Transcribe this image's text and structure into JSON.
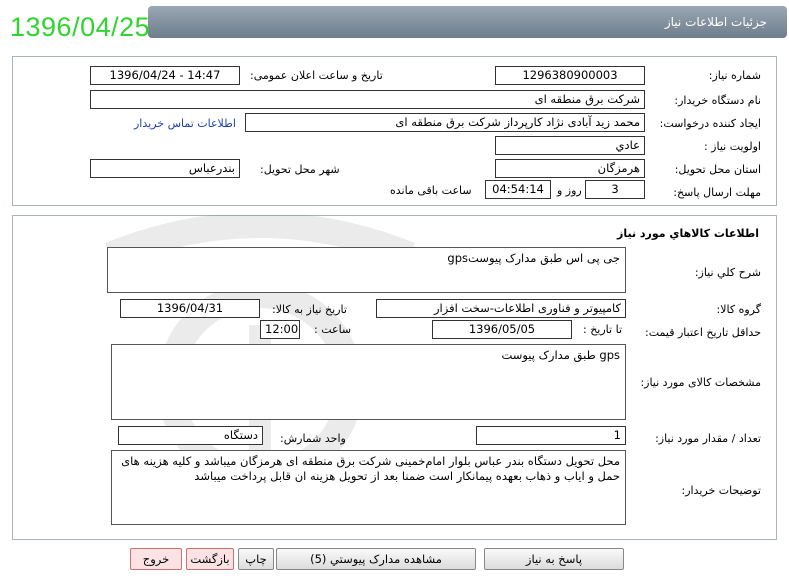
{
  "header": {
    "title": "جزئیات اطلاعات نیاز",
    "date_badge": "1396/04/25"
  },
  "info": {
    "need_number_label": "شماره نیاز:",
    "need_number": "1296380900003",
    "announce_label": "تاریخ و ساعت اعلان عمومی:",
    "announce_value": "1396/04/24 - 14:47",
    "buyer_org_label": "نام دستگاه خریدار:",
    "buyer_org": "شرکت برق منطقه ای",
    "requester_label": "ایجاد کننده درخواست:",
    "requester": "محمد زید آبادی نژاد کارپرداز شرکت برق منطقه ای",
    "contact_link": "اطلاعات تماس خریدار",
    "priority_label": "اولویت نیاز :",
    "priority": "عادي",
    "province_label": "استان محل تحویل:",
    "province": "هرمزگان",
    "city_label": "شهر محل تحویل:",
    "city": "بندرعباس",
    "deadline_label": "مهلت ارسال پاسخ:",
    "deadline_days": "3",
    "days_word": "روز و",
    "deadline_time": "04:54:14",
    "remaining_word": "ساعت باقی مانده"
  },
  "goods": {
    "section_title": "اطلاعات کالاهاي مورد نياز",
    "general_desc_label": "شرح کلي نياز:",
    "general_desc": "جی پی اس  طبق مدارک پیوستgps",
    "group_label": "گروه کالا:",
    "group": "کامپیوتر و فناوری اطلاعات-سخت افزار",
    "need_date_label": "تاریخ نیاز به کالا:",
    "need_date": "1396/04/31",
    "min_validity_label": "حداقل تاریخ اعتبار قیمت:",
    "until_date_label": "تا تاریخ :",
    "until_date": "1396/05/05",
    "time_label": "ساعت :",
    "time": "12:00",
    "specs_label": "مشخصات کالای مورد نیاز:",
    "specs": "gps طبق مدارک پیوست",
    "qty_label": "تعداد / مقدار مورد نیاز:",
    "qty": "1",
    "unit_label": "واحد شمارش:",
    "unit": "دستگاه",
    "buyer_notes_label": "توضیحات خریدار:",
    "buyer_notes": "محل تحویل دستگاه بندر عباس بلوار امام‌خمینی شرکت برق منطقه ای هرمزگان میباشد و کلیه هزینه های حمل و ایاب و ذهاب بعهده پیمانکار است ضمنا  بعد از تحویل هزینه ان قابل پرداخت میباشد"
  },
  "buttons": {
    "reply": "پاسخ به نیاز",
    "view_docs": "مشاهده مدارک پیوستي (5)",
    "print": "چاپ",
    "back": "بازگشت",
    "exit": "خروج"
  }
}
